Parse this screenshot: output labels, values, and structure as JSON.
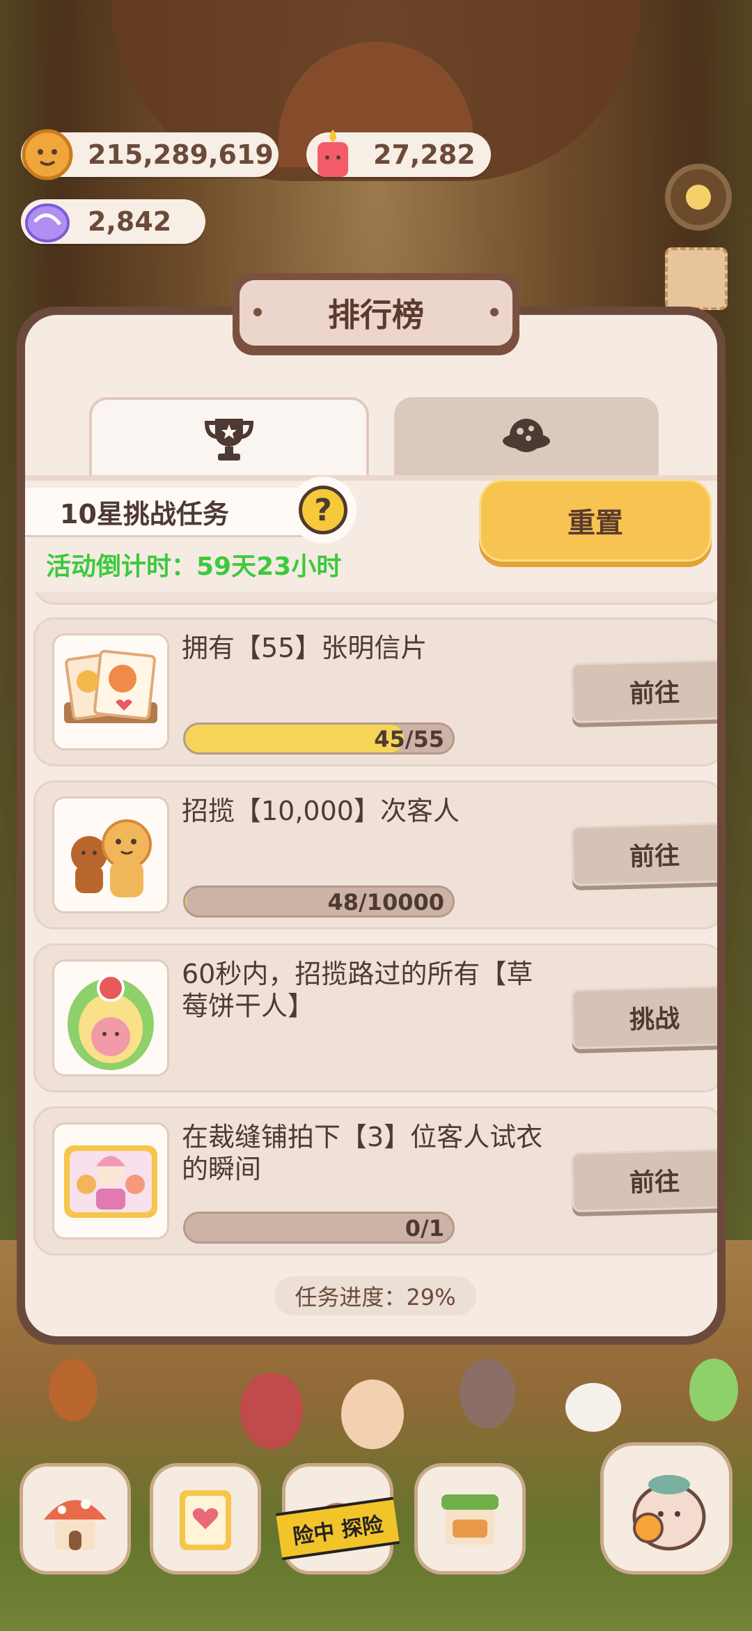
{
  "currency": {
    "cookies": "215,289,619",
    "candles": "27,282",
    "crystals": "2,842"
  },
  "panel": {
    "title": "排行榜",
    "tabs": [
      {
        "icon": "trophy-icon",
        "active": true
      },
      {
        "icon": "planet-icon",
        "active": false
      }
    ],
    "challenge_title": "10星挑战任务",
    "help_label": "?",
    "countdown": "活动倒计时：59天23小时",
    "reset_label": "重置",
    "progress_text": "任务进度：29%"
  },
  "tasks": [
    {
      "desc": "拥有【55】张明信片",
      "progress_label": "45/55",
      "progress": 0.818,
      "button": "前往",
      "thumb": "postcards"
    },
    {
      "desc": "招揽【10,000】次客人",
      "progress_label": "48/10000",
      "progress": 0.0048,
      "button": "前往",
      "thumb": "gingerbread"
    },
    {
      "desc": "60秒内，招揽路过的所有【草莓饼干人】",
      "progress_label": "",
      "progress": null,
      "button": "挑战",
      "thumb": "strawberry-cookie"
    },
    {
      "desc": "在裁缝铺拍下【3】位客人试衣的瞬间",
      "progress_label": "0/1",
      "progress": 0,
      "button": "前往",
      "thumb": "tailor-photo"
    }
  ],
  "nav": {
    "adventure_tape": "险中 探险"
  },
  "colors": {
    "panel_border": "#6c4a3b",
    "panel_bg": "#f6ebe3",
    "accent_yellow": "#f7c452",
    "countdown_green": "#3cc93c"
  }
}
